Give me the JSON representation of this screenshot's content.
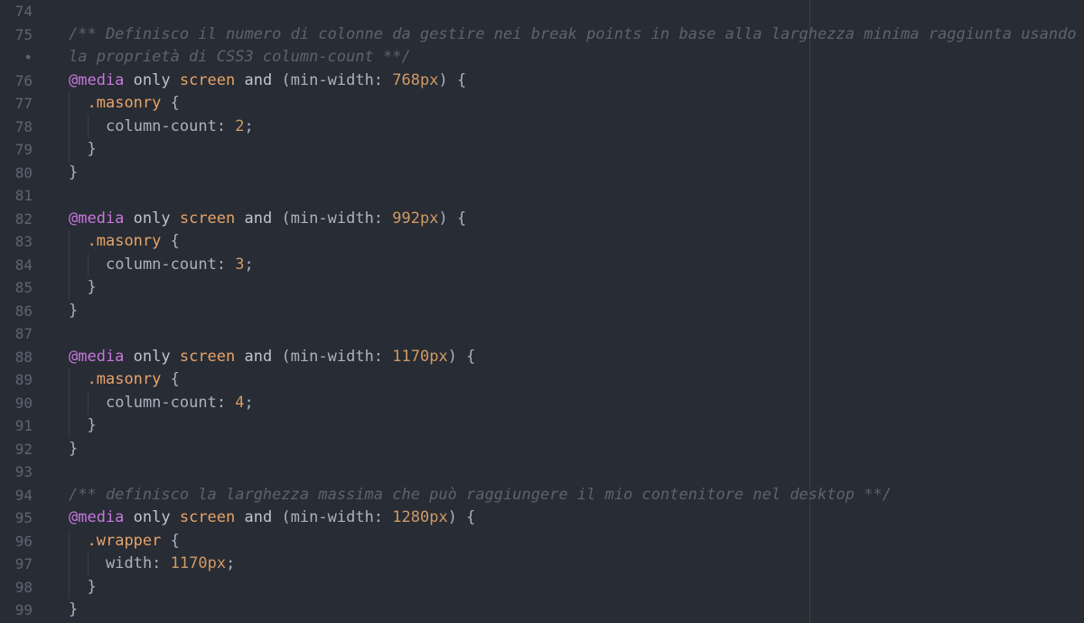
{
  "editor": {
    "lines": [
      {
        "num": "74",
        "indent": 0,
        "tokens": []
      },
      {
        "num": "75",
        "indent": 0,
        "tokens": [
          {
            "t": "/** Definisco il numero di colonne da gestire nei break points in base alla larghezza minima raggiunta usando",
            "c": "comment"
          }
        ]
      },
      {
        "num": "•",
        "indent": 0,
        "tokens": [
          {
            "t": "la proprietà di CSS3 column-count **/",
            "c": "comment"
          }
        ]
      },
      {
        "num": "76",
        "indent": 0,
        "tokens": [
          {
            "t": "@media",
            "c": "at"
          },
          {
            "t": " only ",
            "c": "kw"
          },
          {
            "t": "screen",
            "c": "tag"
          },
          {
            "t": " and ",
            "c": "kw"
          },
          {
            "t": "(min-width: ",
            "c": "plain"
          },
          {
            "t": "768px",
            "c": "num"
          },
          {
            "t": ") {",
            "c": "plain"
          }
        ]
      },
      {
        "num": "77",
        "indent": 1,
        "tokens": [
          {
            "t": ".masonry",
            "c": "sel"
          },
          {
            "t": " {",
            "c": "plain"
          }
        ]
      },
      {
        "num": "78",
        "indent": 2,
        "tokens": [
          {
            "t": "column-count: ",
            "c": "plain"
          },
          {
            "t": "2",
            "c": "num"
          },
          {
            "t": ";",
            "c": "plain"
          }
        ]
      },
      {
        "num": "79",
        "indent": 1,
        "tokens": [
          {
            "t": "}",
            "c": "plain"
          }
        ]
      },
      {
        "num": "80",
        "indent": 0,
        "tokens": [
          {
            "t": "}",
            "c": "plain"
          }
        ]
      },
      {
        "num": "81",
        "indent": 0,
        "tokens": []
      },
      {
        "num": "82",
        "indent": 0,
        "tokens": [
          {
            "t": "@media",
            "c": "at"
          },
          {
            "t": " only ",
            "c": "kw"
          },
          {
            "t": "screen",
            "c": "tag"
          },
          {
            "t": " and ",
            "c": "kw"
          },
          {
            "t": "(min-width: ",
            "c": "plain"
          },
          {
            "t": "992px",
            "c": "num"
          },
          {
            "t": ") {",
            "c": "plain"
          }
        ]
      },
      {
        "num": "83",
        "indent": 1,
        "tokens": [
          {
            "t": ".masonry",
            "c": "sel"
          },
          {
            "t": " {",
            "c": "plain"
          }
        ]
      },
      {
        "num": "84",
        "indent": 2,
        "tokens": [
          {
            "t": "column-count: ",
            "c": "plain"
          },
          {
            "t": "3",
            "c": "num"
          },
          {
            "t": ";",
            "c": "plain"
          }
        ]
      },
      {
        "num": "85",
        "indent": 1,
        "tokens": [
          {
            "t": "}",
            "c": "plain"
          }
        ]
      },
      {
        "num": "86",
        "indent": 0,
        "tokens": [
          {
            "t": "}",
            "c": "plain"
          }
        ]
      },
      {
        "num": "87",
        "indent": 0,
        "tokens": []
      },
      {
        "num": "88",
        "indent": 0,
        "tokens": [
          {
            "t": "@media",
            "c": "at"
          },
          {
            "t": " only ",
            "c": "kw"
          },
          {
            "t": "screen",
            "c": "tag"
          },
          {
            "t": " and ",
            "c": "kw"
          },
          {
            "t": "(min-width: ",
            "c": "plain"
          },
          {
            "t": "1170px",
            "c": "num"
          },
          {
            "t": ") {",
            "c": "plain"
          }
        ]
      },
      {
        "num": "89",
        "indent": 1,
        "tokens": [
          {
            "t": ".masonry",
            "c": "sel"
          },
          {
            "t": " {",
            "c": "plain"
          }
        ]
      },
      {
        "num": "90",
        "indent": 2,
        "tokens": [
          {
            "t": "column-count: ",
            "c": "plain"
          },
          {
            "t": "4",
            "c": "num"
          },
          {
            "t": ";",
            "c": "plain"
          }
        ]
      },
      {
        "num": "91",
        "indent": 1,
        "tokens": [
          {
            "t": "}",
            "c": "plain"
          }
        ]
      },
      {
        "num": "92",
        "indent": 0,
        "tokens": [
          {
            "t": "}",
            "c": "plain"
          }
        ]
      },
      {
        "num": "93",
        "indent": 0,
        "tokens": []
      },
      {
        "num": "94",
        "indent": 0,
        "tokens": [
          {
            "t": "/** definisco la larghezza massima che può raggiungere il mio contenitore nel desktop **/",
            "c": "comment"
          }
        ]
      },
      {
        "num": "95",
        "indent": 0,
        "tokens": [
          {
            "t": "@media",
            "c": "at"
          },
          {
            "t": " only ",
            "c": "kw"
          },
          {
            "t": "screen",
            "c": "tag"
          },
          {
            "t": " and ",
            "c": "kw"
          },
          {
            "t": "(min-width: ",
            "c": "plain"
          },
          {
            "t": "1280px",
            "c": "num"
          },
          {
            "t": ") {",
            "c": "plain"
          }
        ]
      },
      {
        "num": "96",
        "indent": 1,
        "tokens": [
          {
            "t": ".wrapper",
            "c": "sel"
          },
          {
            "t": " {",
            "c": "plain"
          }
        ]
      },
      {
        "num": "97",
        "indent": 2,
        "tokens": [
          {
            "t": "width: ",
            "c": "plain"
          },
          {
            "t": "1170px",
            "c": "num"
          },
          {
            "t": ";",
            "c": "plain"
          }
        ]
      },
      {
        "num": "98",
        "indent": 1,
        "tokens": [
          {
            "t": "}",
            "c": "plain"
          }
        ]
      },
      {
        "num": "99",
        "indent": 0,
        "tokens": [
          {
            "t": "}",
            "c": "plain"
          }
        ]
      }
    ]
  }
}
